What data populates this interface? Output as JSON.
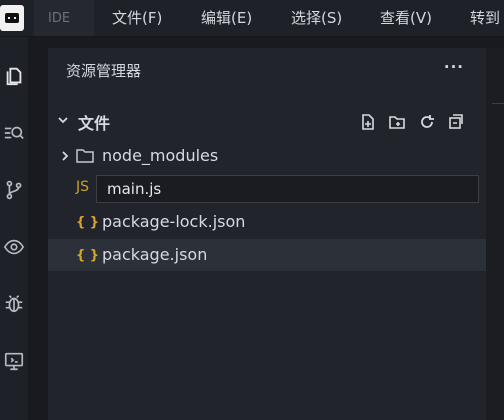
{
  "menubar": {
    "ide_tab": "IDE",
    "items": [
      "文件(F)",
      "编辑(E)",
      "选择(S)",
      "查看(V)",
      "转到"
    ]
  },
  "activitybar": {
    "icons": [
      "explorer-icon",
      "search-icon",
      "source-control-icon",
      "preview-icon",
      "debug-icon",
      "remote-icon"
    ]
  },
  "sidebar": {
    "title": "资源管理器",
    "more": "···",
    "section": {
      "title": "文件",
      "tools": [
        "new-file-icon",
        "new-folder-icon",
        "refresh-icon",
        "collapse-all-icon"
      ]
    },
    "tree": [
      {
        "label": "node_modules",
        "type": "folder"
      },
      {
        "label": "JS",
        "type": "rename",
        "value": "main.js"
      },
      {
        "label": "package-lock.json",
        "type": "json",
        "icon_text": "{ }"
      },
      {
        "label": "package.json",
        "type": "json",
        "icon_text": "{ }"
      }
    ]
  },
  "colors": {
    "json_icon": "#d4a72c",
    "js_icon": "#c9a227",
    "background": "#181a1f",
    "sidebar": "#21242b"
  }
}
